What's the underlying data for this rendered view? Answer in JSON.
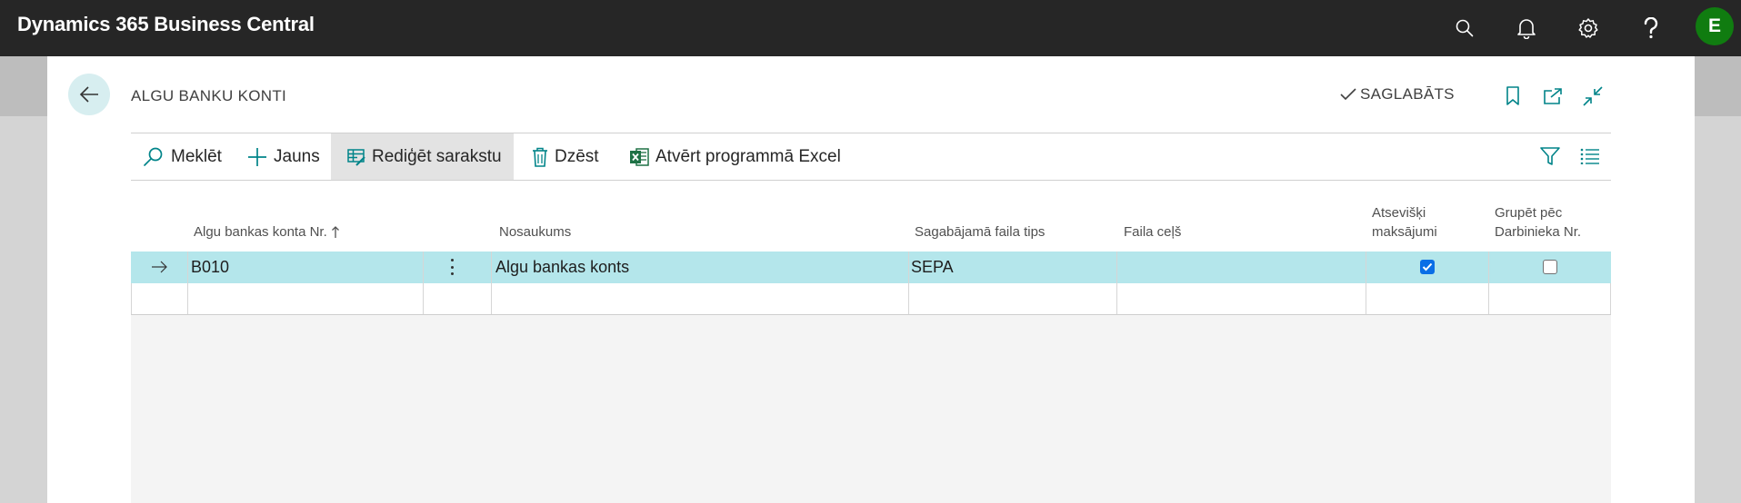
{
  "app": {
    "title": "Dynamics 365 Business Central",
    "user_initial": "E"
  },
  "page": {
    "title": "ALGU BANKU KONTI",
    "status": "SAGLABĀTS"
  },
  "actions": {
    "search": "Meklēt",
    "new": "Jauns",
    "edit_list": "Rediģēt sarakstu",
    "delete": "Dzēst",
    "open_excel": "Atvērt programmā Excel"
  },
  "columns": {
    "account_no": "Algu bankas konta Nr.",
    "name": "Nosaukums",
    "file_type": "Sagabājamā faila tips",
    "file_path": "Faila ceļš",
    "separate_line1": "Atsevišķi",
    "separate_line2": "maksājumi",
    "group_line1": "Grupēt pēc",
    "group_line2": "Darbinieka Nr."
  },
  "rows": [
    {
      "account_no": "B010",
      "name": "Algu bankas konts",
      "file_type": "SEPA",
      "file_path": "",
      "separate": true,
      "group": false
    }
  ],
  "colors": {
    "accent": "#008489",
    "selected_row": "#b4e6eb",
    "topbar": "#262626",
    "avatar": "#107c10"
  }
}
